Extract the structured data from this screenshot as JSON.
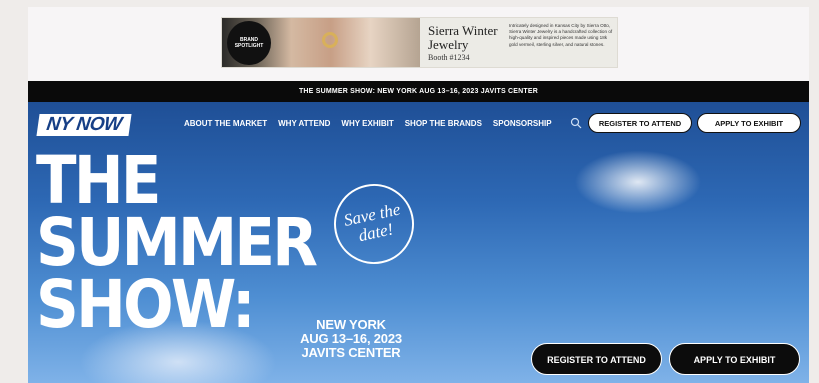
{
  "ad": {
    "badge_text": "BRAND SPOTLIGHT",
    "brand": "Sierra Winter Jewelry",
    "booth": "Booth #1234",
    "description": "Intricately designed in Kansas City by Sierra Otto, Sierra Winter Jewelry is a handcrafted collection of high-quality and inspired pieces made using 18k gold vermeil, sterling silver, and natural stones."
  },
  "strip": {
    "text": "THE SUMMER SHOW: NEW YORK  AUG 13–16, 2023  JAVITS CENTER"
  },
  "nav": {
    "logo": "NY NOW",
    "links": [
      "ABOUT THE MARKET",
      "WHY ATTEND",
      "WHY EXHIBIT",
      "SHOP THE BRANDS",
      "SPONSORSHIP"
    ],
    "register_label": "REGISTER TO ATTEND",
    "apply_label": "APPLY TO EXHIBIT"
  },
  "hero": {
    "line1": "THE",
    "line2": "SUMMER",
    "line3": "SHOW:",
    "save_the_date": "Save the date!",
    "city": "NEW YORK",
    "dates": "AUG 13–16, 2023",
    "venue": "JAVITS CENTER",
    "register_label": "REGISTER TO ATTEND",
    "apply_label": "APPLY TO EXHIBIT"
  },
  "colors": {
    "hero_blue": "#1f4f96",
    "black": "#0a0a0a",
    "white": "#ffffff"
  },
  "icons": {
    "search": "search-icon"
  }
}
